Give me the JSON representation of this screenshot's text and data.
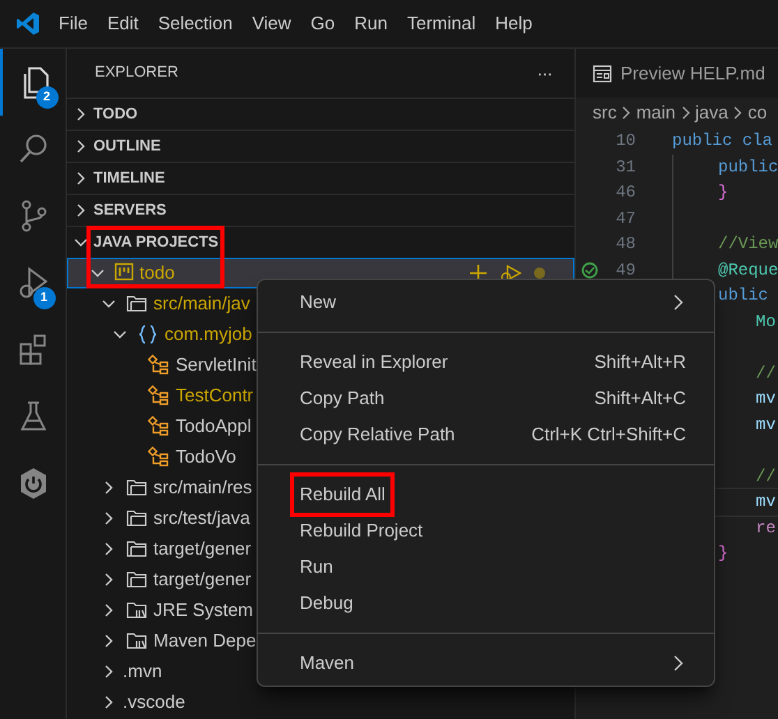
{
  "menu_bar": [
    "File",
    "Edit",
    "Selection",
    "View",
    "Go",
    "Run",
    "Terminal",
    "Help"
  ],
  "activity_bar": [
    {
      "kind": "files",
      "selected": true,
      "badge": "2"
    },
    {
      "kind": "search",
      "selected": false
    },
    {
      "kind": "source-control",
      "selected": false
    },
    {
      "kind": "debug",
      "selected": false,
      "badge": "1"
    },
    {
      "kind": "extensions",
      "selected": false
    },
    {
      "kind": "testing",
      "selected": false
    },
    {
      "kind": "spring",
      "selected": false
    }
  ],
  "sidebar": {
    "title": "EXPLORER",
    "more": "···",
    "sections": [
      {
        "label": "TODO",
        "expanded": false,
        "annotated": false
      },
      {
        "label": "OUTLINE",
        "expanded": false,
        "annotated": false
      },
      {
        "label": "TIMELINE",
        "expanded": false,
        "annotated": false
      },
      {
        "label": "SERVERS",
        "expanded": false,
        "annotated": false
      },
      {
        "label": "JAVA PROJECTS",
        "expanded": true,
        "annotated": true,
        "tree": [
          {
            "label": "todo",
            "kind": "project",
            "expanded": true,
            "selected": true,
            "modified": true,
            "children": [
              {
                "label": "src/main/jav",
                "kind": "source",
                "expanded": true,
                "selected": false,
                "modified": true,
                "children": [
                  {
                    "label": "com.myjob",
                    "kind": "package",
                    "expanded": true,
                    "selected": false,
                    "modified": true,
                    "children": [
                      {
                        "label": "ServletInit",
                        "kind": "class",
                        "selected": false,
                        "modified": false
                      },
                      {
                        "label": "TestContr",
                        "kind": "class",
                        "selected": false,
                        "modified": true
                      },
                      {
                        "label": "TodoAppl",
                        "kind": "class",
                        "selected": false,
                        "modified": false
                      },
                      {
                        "label": "TodoVo",
                        "kind": "class",
                        "selected": false,
                        "modified": false
                      }
                    ]
                  }
                ]
              },
              {
                "label": "src/main/res",
                "kind": "source",
                "expanded": false,
                "selected": false,
                "modified": false
              },
              {
                "label": "src/test/java",
                "kind": "source",
                "expanded": false,
                "selected": false,
                "modified": false
              },
              {
                "label": "target/gener",
                "kind": "source",
                "expanded": false,
                "selected": false,
                "modified": false
              },
              {
                "label": "target/gener",
                "kind": "source",
                "expanded": false,
                "selected": false,
                "modified": false
              },
              {
                "label": "JRE System",
                "kind": "library",
                "expanded": false,
                "selected": false,
                "modified": false
              },
              {
                "label": "Maven Depe",
                "kind": "library",
                "expanded": false,
                "selected": false,
                "modified": false
              },
              {
                "label": ".mvn",
                "kind": "folder",
                "expanded": false,
                "selected": false,
                "modified": false
              },
              {
                "label": ".vscode",
                "kind": "folder",
                "expanded": false,
                "selected": false,
                "modified": false
              }
            ]
          }
        ]
      }
    ]
  },
  "editor": {
    "tab": "Preview HELP.md",
    "breadcrumb": [
      "src",
      "main",
      "java",
      "co"
    ],
    "lines": [
      {
        "number": "10",
        "code": "public cla",
        "kind": "outer",
        "color": "#569cd6"
      },
      {
        "number": "31",
        "code": "public",
        "kind": "member",
        "color": "#569cd6"
      },
      {
        "number": "46",
        "code": "}",
        "kind": "member",
        "color": "#da70d6"
      },
      {
        "number": "47",
        "kind": "member"
      },
      {
        "number": "48",
        "code": "//View",
        "kind": "member",
        "color": "#6a9955"
      },
      {
        "number": "49",
        "code": "@Reque",
        "kind": "member",
        "color": "#4ec9b0",
        "gutter_icon": true
      },
      {
        "code": "ublic",
        "kind": "member",
        "color": "#569cd6"
      },
      {
        "code": "Mo",
        "kind": "body",
        "color": "#4ec9b0"
      },
      {
        "kind": "body"
      },
      {
        "code": "//",
        "kind": "body",
        "color": "#6a9955"
      },
      {
        "code": "mv",
        "kind": "body",
        "color": "#9cdcfe"
      },
      {
        "code": "mv",
        "kind": "body",
        "color": "#9cdcfe"
      },
      {
        "kind": "body"
      },
      {
        "code": "//",
        "kind": "body",
        "color": "#6a9955"
      },
      {
        "code": "mv",
        "kind": "body",
        "color": "#9cdcfe",
        "current": true
      },
      {
        "code": "re",
        "kind": "body",
        "color": "#c586c0"
      },
      {
        "code": "}",
        "kind": "member",
        "color": "#da70d6"
      }
    ]
  },
  "context_menu": [
    {
      "kind": "item",
      "label": "New",
      "submenu": true,
      "annotated": false
    },
    {
      "kind": "separator"
    },
    {
      "kind": "item",
      "label": "Reveal in Explorer",
      "shortcut": "Shift+Alt+R",
      "annotated": false
    },
    {
      "kind": "item",
      "label": "Copy Path",
      "shortcut": "Shift+Alt+C",
      "annotated": false
    },
    {
      "kind": "item",
      "label": "Copy Relative Path",
      "shortcut": "Ctrl+K Ctrl+Shift+C",
      "annotated": false
    },
    {
      "kind": "separator"
    },
    {
      "kind": "item",
      "label": "Rebuild All",
      "annotated": true
    },
    {
      "kind": "item",
      "label": "Rebuild Project",
      "annotated": false
    },
    {
      "kind": "item",
      "label": "Run",
      "annotated": false
    },
    {
      "kind": "item",
      "label": "Debug",
      "annotated": false
    },
    {
      "kind": "separator"
    },
    {
      "kind": "item",
      "label": "Maven",
      "submenu": true,
      "annotated": false
    }
  ]
}
